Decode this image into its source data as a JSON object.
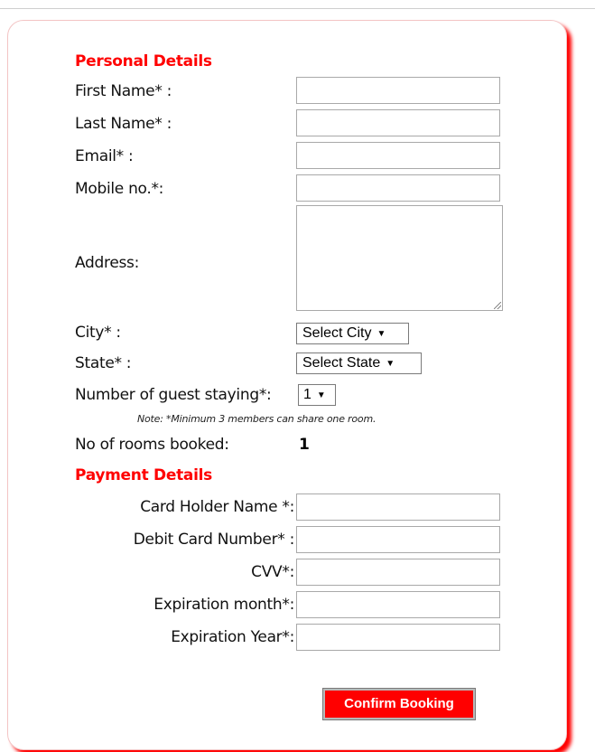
{
  "personal": {
    "heading": "Personal Details",
    "first_name_label": "First Name* :",
    "last_name_label": "Last Name* :",
    "email_label": "Email* :",
    "mobile_label": "Mobile no.*:",
    "address_label": "Address:",
    "city_label": "City* :",
    "city_value": "Select City",
    "state_label": "State* :",
    "state_value": "Select State",
    "guests_label": "Number of guest staying*:",
    "guests_value": "1",
    "note": "Note: *Minimum 3 members can share one room.",
    "rooms_label": "No of rooms booked:",
    "rooms_value": "1"
  },
  "payment": {
    "heading": "Payment Details",
    "card_holder_label": "Card Holder Name *:",
    "debit_card_label": "Debit Card Number* :",
    "cvv_label": "CVV*:",
    "exp_month_label": "Expiration month*:",
    "exp_year_label": "Expiration Year*:"
  },
  "actions": {
    "confirm_label": "Confirm Booking"
  },
  "colors": {
    "accent": "#ff0000"
  }
}
